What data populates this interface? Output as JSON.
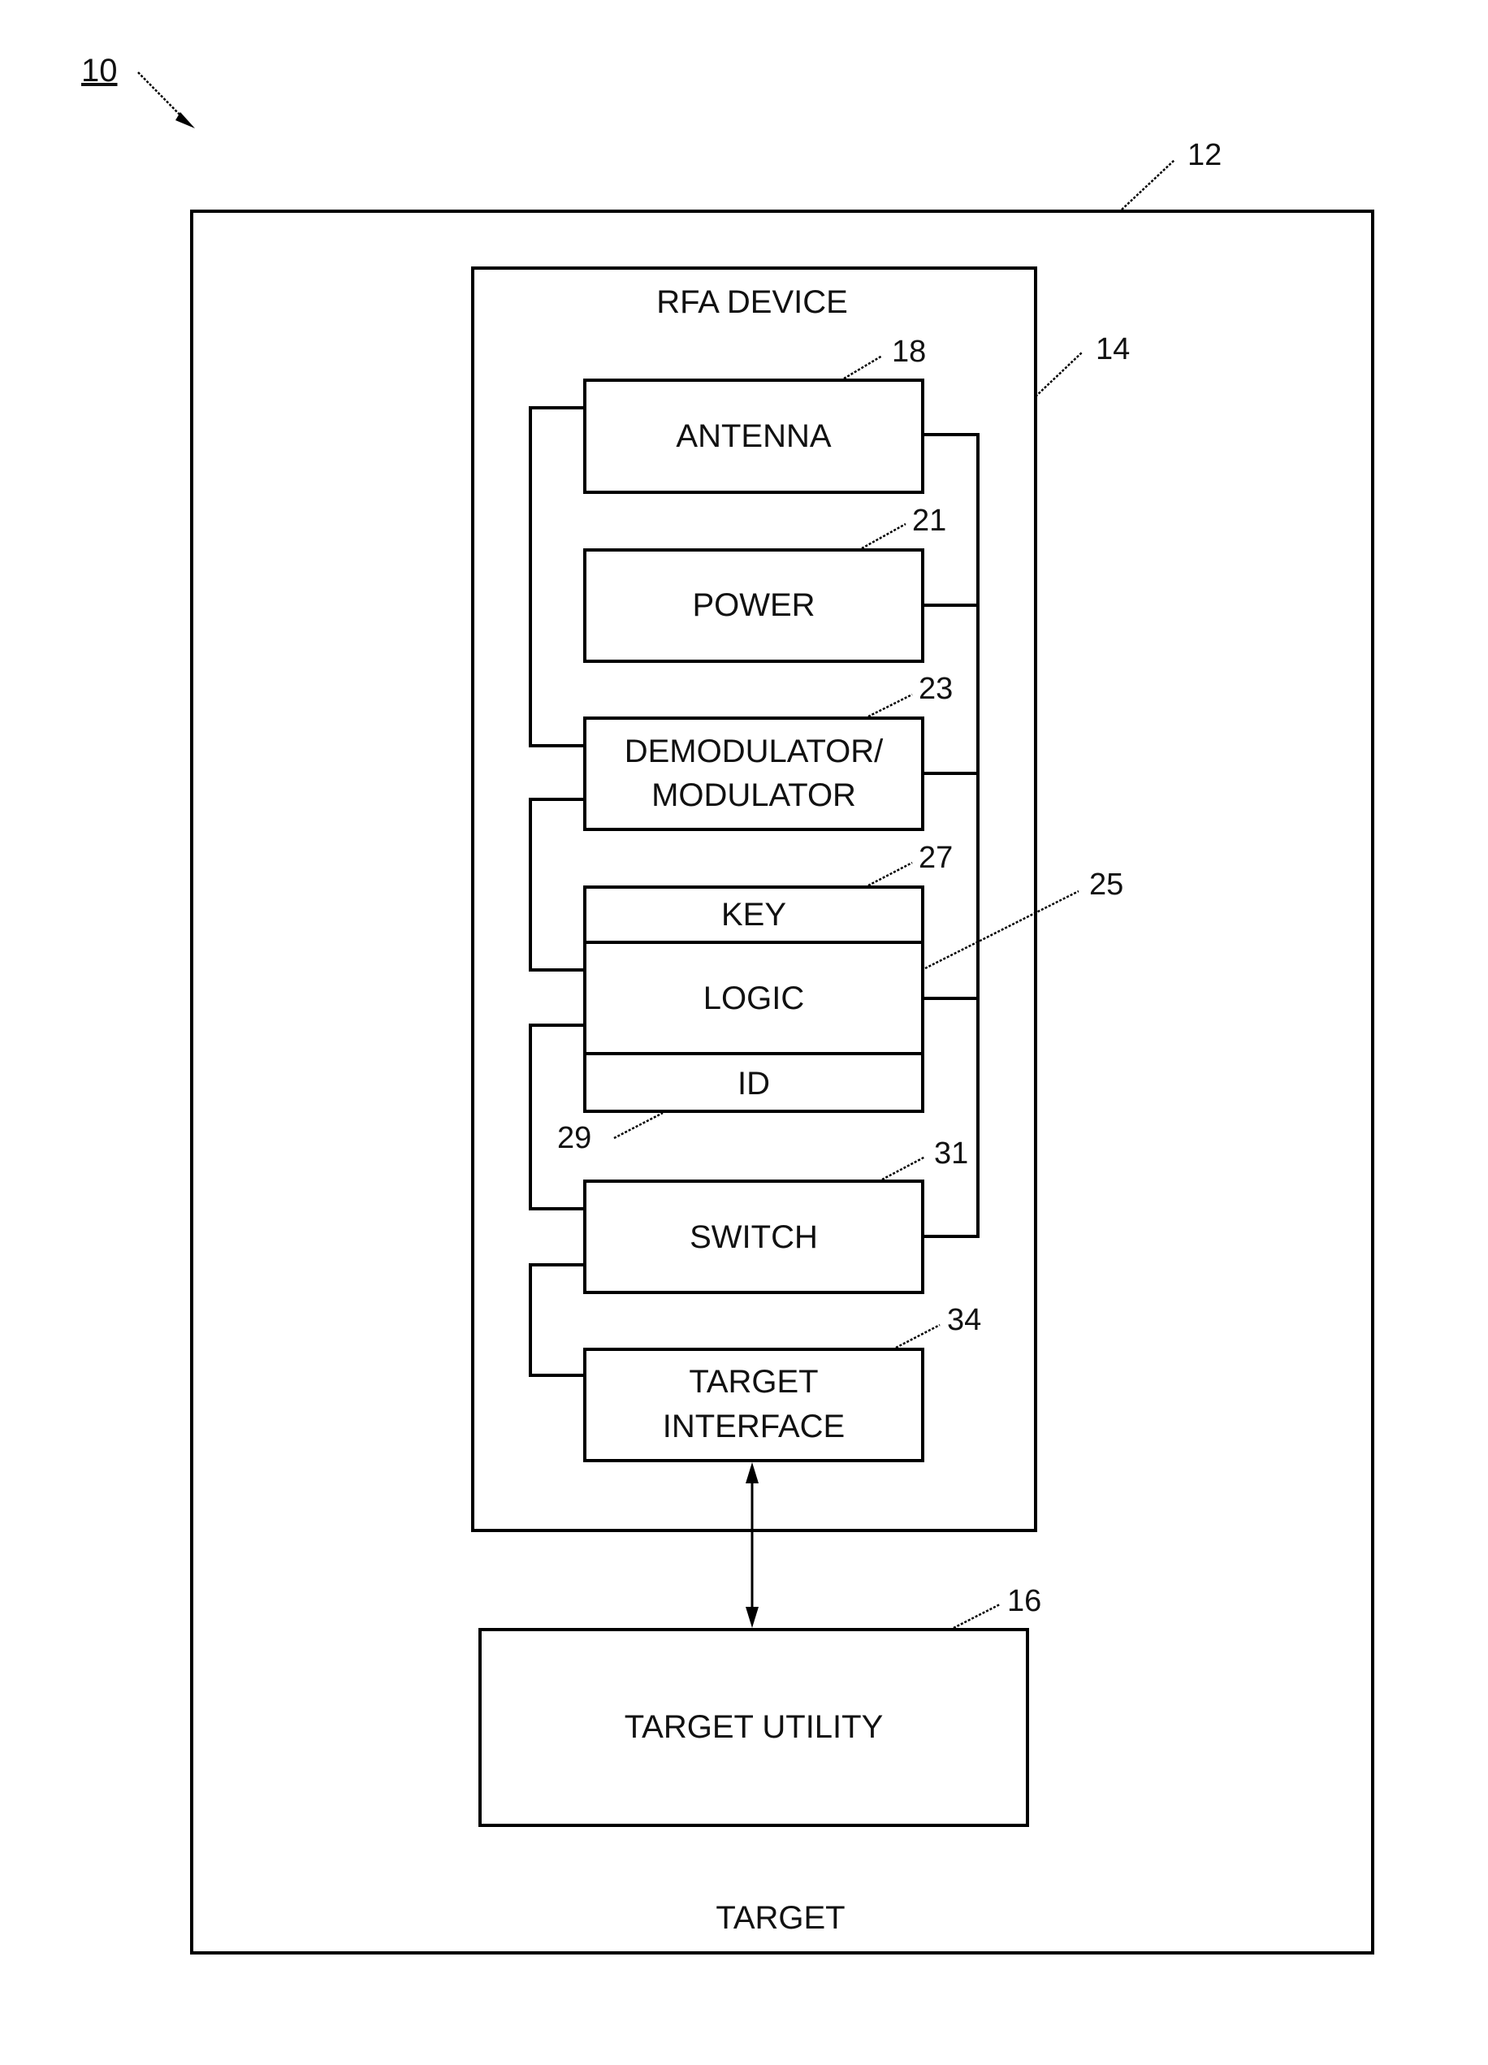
{
  "figure": {
    "reference": "10",
    "target": {
      "label": "TARGET",
      "ref": "12"
    },
    "rfa_device": {
      "label": "RFA DEVICE",
      "ref": "14"
    },
    "blocks": {
      "antenna": {
        "label": "ANTENNA",
        "ref": "18"
      },
      "power": {
        "label": "POWER",
        "ref": "21"
      },
      "demodulator": {
        "line1": "DEMODULATOR/",
        "line2": "MODULATOR",
        "ref": "23"
      },
      "logic": {
        "key_label": "KEY",
        "key_ref": "27",
        "label": "LOGIC",
        "ref": "25",
        "id_label": "ID",
        "id_ref": "29"
      },
      "switch": {
        "label": "SWITCH",
        "ref": "31"
      },
      "target_interface": {
        "line1": "TARGET",
        "line2": "INTERFACE",
        "ref": "34"
      }
    },
    "target_utility": {
      "label": "TARGET UTILITY",
      "ref": "16"
    }
  }
}
